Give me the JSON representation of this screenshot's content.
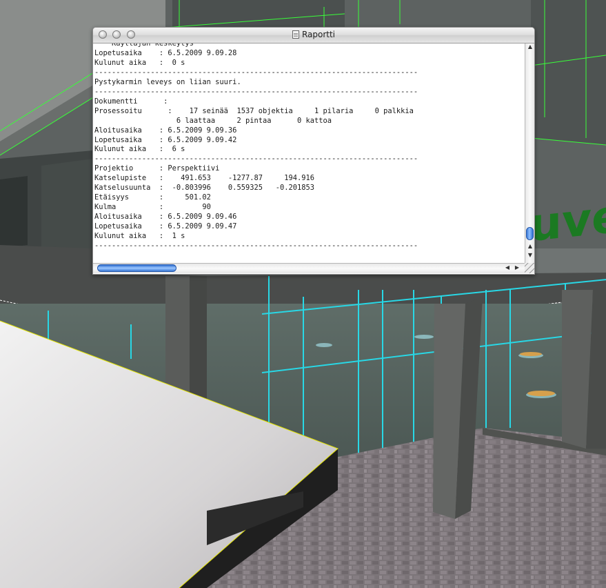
{
  "window": {
    "title": "Raportti"
  },
  "report_lines": [
    "*** Käyttäjän keskeytys ***",
    "Lopetusaika    : 6.5.2009 9.09.28",
    "Kulunut aika   :  0 s",
    "---------------------------------------------------------------------------",
    "Pystykarmin leveys on liian suuri.",
    "---------------------------------------------------------------------------",
    "Dokumentti      :",
    "Prosessoitu      :    17 seinää  1537 objektia     1 pilaria     0 palkkia",
    "                   6 laattaa     2 pintaa      0 kattoa",
    "Aloitusaika    : 6.5.2009 9.09.36",
    "Lopetusaika    : 6.5.2009 9.09.42",
    "Kulunut aika   :  6 s",
    "---------------------------------------------------------------------------",
    "Projektio      : Perspektiivi",
    "Katselupiste   :    491.653    -1277.87     194.916",
    "Katselusuunta  :  -0.803996    0.559325   -0.201853",
    "Etäisyys       :     501.02",
    "Kulma          :         90",
    "Aloitusaika    : 6.5.2009 9.09.46",
    "Lopetusaika    : 6.5.2009 9.09.47",
    "Kulunut aika   :  1 s",
    "---------------------------------------------------------------------------"
  ],
  "scene": {
    "sign_text": "uver"
  },
  "icons": {
    "close": "close-icon",
    "minimize": "minimize-icon",
    "zoom": "zoom-icon",
    "document": "document-icon"
  },
  "colors": {
    "scroll_thumb": "#3a78d6",
    "edge_highlight": "#39ff39",
    "glass_edge": "#28d8e6"
  }
}
